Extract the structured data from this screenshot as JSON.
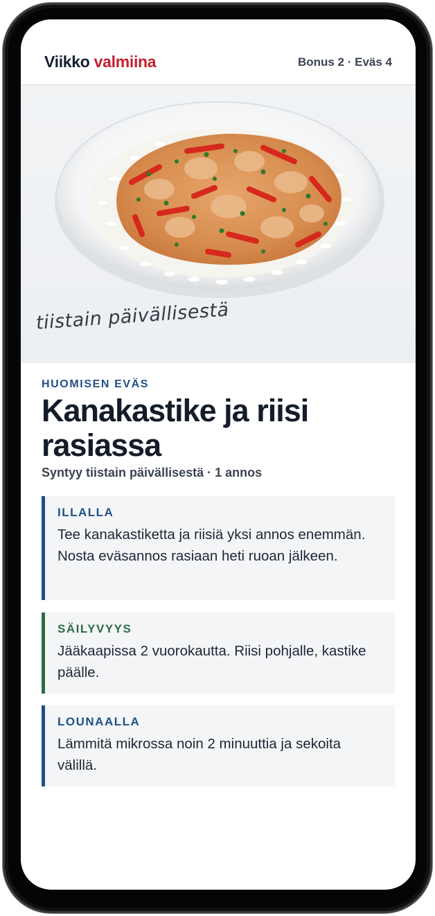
{
  "header": {
    "brand_part1": "Viikko",
    "brand_part2": "valmiina",
    "counters": "Bonus 2 · Eväs 4"
  },
  "hero": {
    "image_icon": "chicken-sauce-rice-plate-photo",
    "caption": "tiistain päivällisestä"
  },
  "main": {
    "kicker": "HUOMISEN EVÄS",
    "title": "Kanakastike ja riisi rasiassa",
    "subtitle": "Syntyy tiistain päivällisestä · 1 annos"
  },
  "cards": [
    {
      "label": "ILLALLA",
      "text": "Tee kanakastiketta ja riisiä yksi annos enemmän. Nosta eväsannos rasiaan heti ruoan jälkeen."
    },
    {
      "label": "SÄILYVYYS",
      "text": "Jääkaapissa 2 vuorokautta. Riisi pohjalle, kastike päälle."
    },
    {
      "label": "LOUNAALLA",
      "text": "Lämmitä mikrossa noin 2 minuuttia ja sekoita välillä."
    }
  ],
  "colors": {
    "brand_dark": "#152033",
    "brand_red": "#c3202f",
    "accent_blue": "#1f4f86",
    "accent_green": "#2e6b45",
    "card_bg": "#f3f5f7"
  }
}
